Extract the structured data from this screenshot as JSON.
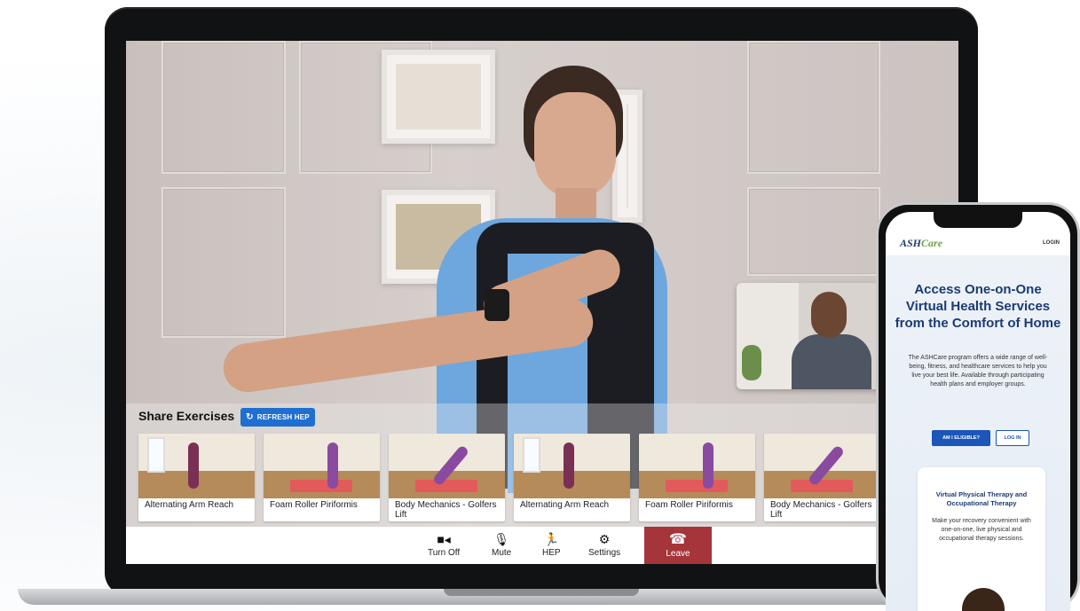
{
  "laptop": {
    "share": {
      "title": "Share Exercises",
      "refresh_label": "REFRESH HEP",
      "exercises": [
        {
          "caption": "Alternating Arm Reach"
        },
        {
          "caption": "Foam Roller Piriformis"
        },
        {
          "caption": "Body Mechanics - Golfers Lift"
        },
        {
          "caption": "Alternating Arm Reach"
        },
        {
          "caption": "Foam Roller Piriformis"
        },
        {
          "caption": "Body Mechanics - Golfers Lift"
        }
      ]
    },
    "controls": {
      "camera": {
        "label": "Turn Off",
        "icon": "video-camera-icon"
      },
      "mute": {
        "label": "Mute",
        "icon": "microphone-icon"
      },
      "hep": {
        "label": "HEP",
        "icon": "running-person-icon"
      },
      "settings": {
        "label": "Settings",
        "icon": "gear-icon"
      },
      "leave": {
        "label": "Leave",
        "icon": "hang-up-phone-icon"
      }
    },
    "colors": {
      "refresh": "#1f6fd1",
      "leave": "#a5343b"
    }
  },
  "phone": {
    "logo_ash": "ASH",
    "logo_care": "Care",
    "login_label": "LOGIN",
    "hero_title": "Access One-on-One Virtual Health Services from the Comfort of Home",
    "hero_desc": "The ASHCare program offers a wide range of well-being, fitness, and healthcare services to help you live your best life. Available through participating health plans and employer groups.",
    "eligible_button": "AM I ELIGIBLE?",
    "login_button": "LOG IN",
    "card": {
      "title": "Virtual Physical Therapy and Occupational Therapy",
      "desc": "Make your recovery convenient with one-on-one, live physical and occupational therapy sessions."
    },
    "colors": {
      "brand_blue": "#1b3b72",
      "brand_green": "#6ca241",
      "button_blue": "#1b56b8"
    }
  }
}
